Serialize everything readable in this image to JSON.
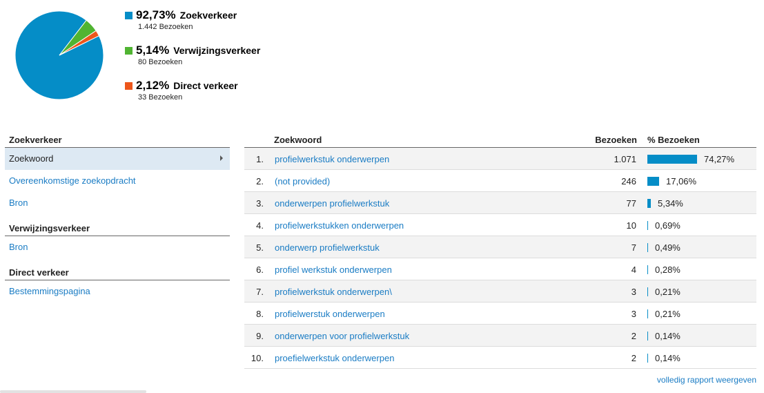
{
  "colors": {
    "search": "#058dc7",
    "referral": "#50b432",
    "direct": "#ed561b",
    "link": "#1a7cc4"
  },
  "chart_data": {
    "type": "pie",
    "slices": [
      {
        "name": "Zoekverkeer",
        "percent": 92.73,
        "visits": 1442,
        "color": "#058dc7"
      },
      {
        "name": "Verwijzingsverkeer",
        "percent": 5.14,
        "visits": 80,
        "color": "#50b432"
      },
      {
        "name": "Direct verkeer",
        "percent": 2.12,
        "visits": 33,
        "color": "#ed561b"
      }
    ]
  },
  "legend": [
    {
      "pct": "92,73%",
      "name": "Zoekverkeer",
      "sub": "1.442 Bezoeken",
      "color": "#058dc7"
    },
    {
      "pct": "5,14%",
      "name": "Verwijzingsverkeer",
      "sub": "80 Bezoeken",
      "color": "#50b432"
    },
    {
      "pct": "2,12%",
      "name": "Direct verkeer",
      "sub": "33 Bezoeken",
      "color": "#ed561b"
    }
  ],
  "nav": {
    "search": {
      "header": "Zoekverkeer",
      "items": [
        "Zoekwoord",
        "Overeenkomstige zoekopdracht",
        "Bron"
      ]
    },
    "referral": {
      "header": "Verwijzingsverkeer",
      "items": [
        "Bron"
      ]
    },
    "direct": {
      "header": "Direct verkeer",
      "items": [
        "Bestemmingspagina"
      ]
    }
  },
  "table": {
    "headers": {
      "keyword": "Zoekwoord",
      "visits": "Bezoeken",
      "pct": "% Bezoeken"
    },
    "rows": [
      {
        "rank": "1.",
        "keyword": "profielwerkstuk onderwerpen",
        "visits": "1.071",
        "pct": "74,27%",
        "value": 74.27
      },
      {
        "rank": "2.",
        "keyword": "(not provided)",
        "visits": "246",
        "pct": "17,06%",
        "value": 17.06
      },
      {
        "rank": "3.",
        "keyword": "onderwerpen profielwerkstuk",
        "visits": "77",
        "pct": "5,34%",
        "value": 5.34
      },
      {
        "rank": "4.",
        "keyword": "profielwerkstukken onderwerpen",
        "visits": "10",
        "pct": "0,69%",
        "value": 0.69
      },
      {
        "rank": "5.",
        "keyword": "onderwerp profielwerkstuk",
        "visits": "7",
        "pct": "0,49%",
        "value": 0.49
      },
      {
        "rank": "6.",
        "keyword": "profiel werkstuk onderwerpen",
        "visits": "4",
        "pct": "0,28%",
        "value": 0.28
      },
      {
        "rank": "7.",
        "keyword": "profielwerkstuk onderwerpen\\",
        "visits": "3",
        "pct": "0,21%",
        "value": 0.21
      },
      {
        "rank": "8.",
        "keyword": "profielwerstuk onderwerpen",
        "visits": "3",
        "pct": "0,21%",
        "value": 0.21
      },
      {
        "rank": "9.",
        "keyword": "onderwerpen voor profielwerkstuk",
        "visits": "2",
        "pct": "0,14%",
        "value": 0.14
      },
      {
        "rank": "10.",
        "keyword": "proefielwerkstuk onderwerpen",
        "visits": "2",
        "pct": "0,14%",
        "value": 0.14
      }
    ]
  },
  "footer": {
    "full_report": "volledig rapport weergeven"
  }
}
